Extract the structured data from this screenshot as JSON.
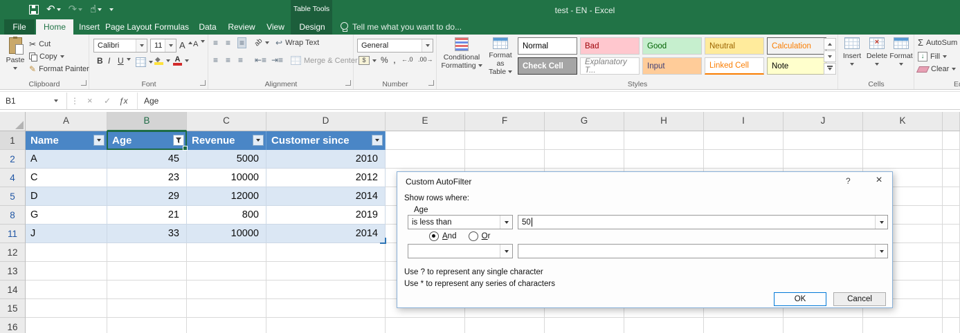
{
  "title_bar": {
    "title": "test - EN - Excel",
    "contextual_label": "Table Tools",
    "qat_icons": [
      "save",
      "undo",
      "redo",
      "touch-mode",
      "customize-quick-access-toolbar"
    ]
  },
  "tabs": {
    "tell_me": "Tell me what you want to do...",
    "items": [
      {
        "label": "File",
        "style": "file"
      },
      {
        "label": "Home",
        "style": "active"
      },
      {
        "label": "Insert"
      },
      {
        "label": "Page Layout"
      },
      {
        "label": "Formulas"
      },
      {
        "label": "Data"
      },
      {
        "label": "Review"
      },
      {
        "label": "View"
      },
      {
        "label": "Design",
        "style": "contextual"
      }
    ]
  },
  "ribbon": {
    "clipboard": {
      "label": "Clipboard",
      "paste": "Paste",
      "cut": "Cut",
      "copy": "Copy",
      "format_painter": "Format Painter"
    },
    "font": {
      "label": "Font",
      "family": "Calibri",
      "size": "11",
      "bold": "B",
      "italic": "I",
      "underline": "U"
    },
    "alignment": {
      "label": "Alignment",
      "wrap_text": "Wrap Text",
      "merge_center": "Merge & Center"
    },
    "number": {
      "label": "Number",
      "format": "General"
    },
    "styles": {
      "label": "Styles",
      "conditional_line1": "Conditional",
      "conditional_line2": "Formatting",
      "format_table_line1": "Format as",
      "format_table_line2": "Table",
      "gallery": [
        {
          "name": "Normal",
          "bg": "#ffffff",
          "fg": "#000000",
          "style": "selected"
        },
        {
          "name": "Bad",
          "bg": "#ffc7ce",
          "fg": "#9c0006",
          "style": "plain"
        },
        {
          "name": "Good",
          "bg": "#c6efce",
          "fg": "#006100",
          "style": "plain"
        },
        {
          "name": "Neutral",
          "bg": "#ffeb9c",
          "fg": "#9c6500",
          "style": "plain"
        },
        {
          "name": "Calculation",
          "bg": "#f2f2f2",
          "fg": "#fa7d00",
          "style": "boxed"
        },
        {
          "name": "Check Cell",
          "bg": "#a5a5a5",
          "fg": "#ffffff",
          "style": "boxed-bold"
        },
        {
          "name": "Explanatory T...",
          "bg": "#ffffff",
          "fg": "#7f7f7f",
          "style": "italic"
        },
        {
          "name": "Input",
          "bg": "#ffcc99",
          "fg": "#3f3f76",
          "style": "plain"
        },
        {
          "name": "Linked Cell",
          "bg": "#ffffff",
          "fg": "#fa7d00",
          "style": "underline"
        },
        {
          "name": "Note",
          "bg": "#ffffcc",
          "fg": "#000000",
          "style": "boxed-light"
        }
      ]
    },
    "cells": {
      "label": "Cells",
      "insert": "Insert",
      "delete": "Delete",
      "format": "Format"
    },
    "editing": {
      "label": "Editing",
      "autosum": "AutoSum",
      "fill": "Fill",
      "clear": "Clear"
    }
  },
  "formula_bar": {
    "name_box": "B1",
    "content": "Age"
  },
  "sheet": {
    "row_header_width": 37,
    "selected_column": "B",
    "selected_cell": "B1",
    "columns": [
      {
        "letter": "A",
        "width": 118
      },
      {
        "letter": "B",
        "width": 115
      },
      {
        "letter": "C",
        "width": 115
      },
      {
        "letter": "D",
        "width": 172
      },
      {
        "letter": "E",
        "width": 115
      },
      {
        "letter": "F",
        "width": 115
      },
      {
        "letter": "G",
        "width": 115
      },
      {
        "letter": "H",
        "width": 115
      },
      {
        "letter": "I",
        "width": 115
      },
      {
        "letter": "J",
        "width": 115
      },
      {
        "letter": "K",
        "width": 115
      },
      {
        "letter": "",
        "width": 25
      }
    ],
    "rows": [
      {
        "n": "1"
      },
      {
        "n": "2",
        "filtered": true
      },
      {
        "n": "4",
        "filtered": true
      },
      {
        "n": "5",
        "filtered": true
      },
      {
        "n": "8",
        "filtered": true
      },
      {
        "n": "11",
        "filtered": true
      },
      {
        "n": "12"
      },
      {
        "n": "13"
      },
      {
        "n": "14"
      },
      {
        "n": "15"
      },
      {
        "n": "16"
      }
    ],
    "table": {
      "columns": [
        "Name",
        "Age",
        "Revenue",
        "Customer since"
      ],
      "filtered_column": "Age",
      "rows": [
        [
          "A",
          "45",
          "5000",
          "2010"
        ],
        [
          "C",
          "23",
          "10000",
          "2012"
        ],
        [
          "D",
          "29",
          "12000",
          "2014"
        ],
        [
          "G",
          "21",
          "800",
          "2019"
        ],
        [
          "J",
          "33",
          "10000",
          "2014"
        ]
      ]
    },
    "colors": {
      "table_header": "#4a86c6",
      "band": "#dbe7f4",
      "grid": "#d9d9d9",
      "selection": "#1e6a45",
      "filtered_row_number": "#2056a4",
      "accent_green": "#217346"
    }
  },
  "dialog": {
    "title": "Custom AutoFilter",
    "help_icon": "?",
    "close_icon": "×",
    "show_rows_where": "Show rows where:",
    "field": "Age",
    "condition1": {
      "operator": "is less than",
      "value": "50"
    },
    "logic": {
      "and": "And",
      "or": "Or",
      "selected": "And"
    },
    "condition2": {
      "operator": "",
      "value": ""
    },
    "hint1": "Use ? to represent any single character",
    "hint2": "Use * to represent any series of characters",
    "ok": "OK",
    "cancel": "Cancel"
  }
}
